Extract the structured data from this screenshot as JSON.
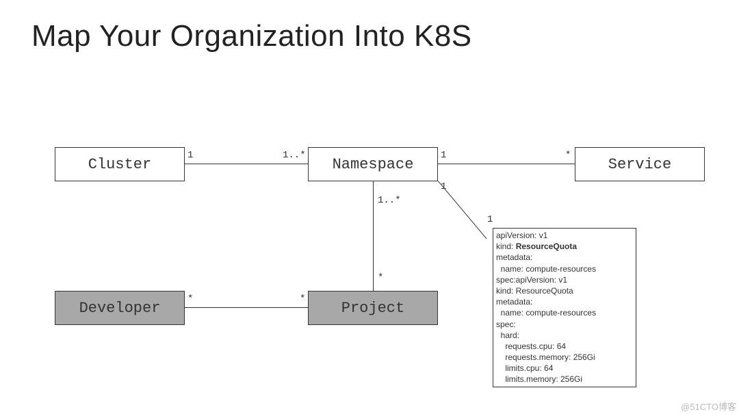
{
  "title": "Map Your Organization Into K8S",
  "boxes": {
    "cluster": "Cluster",
    "namespace": "Namespace",
    "service": "Service",
    "developer": "Developer",
    "project": "Project"
  },
  "multiplicities": {
    "cluster_ns_left": "1",
    "cluster_ns_right": "1..*",
    "ns_service_left": "1",
    "ns_service_right": "*",
    "ns_proj_top": "1..*",
    "ns_proj_bottom": "*",
    "dev_proj_left": "*",
    "dev_proj_right": "*",
    "ns_code_top": "1",
    "ns_code_bottom": "1"
  },
  "code": {
    "l1": "apiVersion: v1",
    "l2a": "kind: ",
    "l2b": "ResourceQuota",
    "l3": "metadata:",
    "l4": "  name: compute-resources",
    "l5": "spec:apiVersion: v1",
    "l6": "kind: ResourceQuota",
    "l7": "metadata:",
    "l8": "  name: compute-resources",
    "l9": "spec:",
    "l10": "  hard:",
    "l11": "    requests.cpu: 64",
    "l12": "    requests.memory: 256Gi",
    "l13": "    limits.cpu: 64",
    "l14": "    limits.memory: 256Gi"
  },
  "watermark": "@51CTO博客"
}
